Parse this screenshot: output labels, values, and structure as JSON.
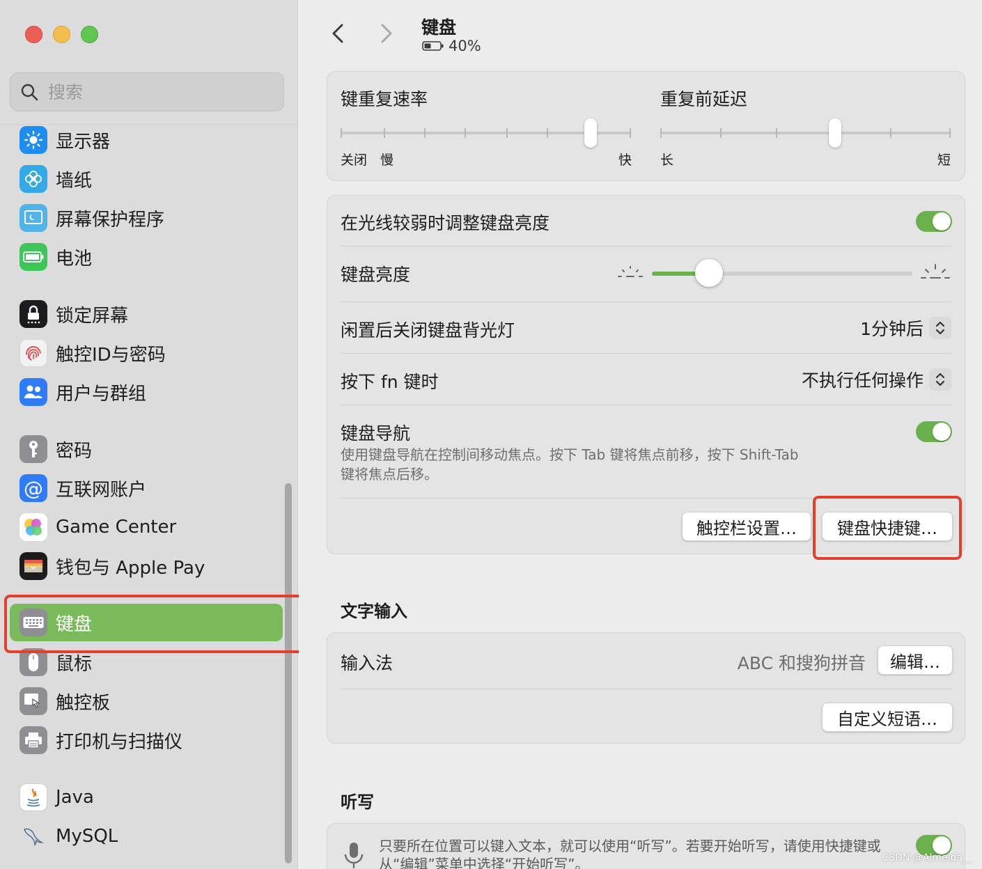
{
  "sidebar": {
    "search_placeholder": "搜索",
    "groups": [
      [
        {
          "id": "display",
          "label": "显示器",
          "icon": "sun-icon",
          "color": "#1f8cf0"
        },
        {
          "id": "wallpaper",
          "label": "墙纸",
          "icon": "flower-icon",
          "color": "#35a8e8"
        },
        {
          "id": "screensaver",
          "label": "屏幕保护程序",
          "icon": "screensaver-icon",
          "color": "#52b3e8"
        },
        {
          "id": "battery",
          "label": "电池",
          "icon": "battery-icon",
          "color": "#3dc55a"
        }
      ],
      [
        {
          "id": "lockscreen",
          "label": "锁定屏幕",
          "icon": "lock-icon",
          "color": "#1c1c1e"
        },
        {
          "id": "touchid",
          "label": "触控ID与密码",
          "icon": "fingerprint-icon",
          "color": "#f2f2f2"
        },
        {
          "id": "users",
          "label": "用户与群组",
          "icon": "users-icon",
          "color": "#2f7cf6"
        }
      ],
      [
        {
          "id": "passwords",
          "label": "密码",
          "icon": "key-icon",
          "color": "#8e8e93"
        },
        {
          "id": "internet-accounts",
          "label": "互联网账户",
          "icon": "at-icon",
          "color": "#2f7cf6"
        },
        {
          "id": "game-center",
          "label": "Game Center",
          "icon": "game-center-icon",
          "color": "#ffffff"
        },
        {
          "id": "wallet",
          "label": "钱包与 Apple Pay",
          "icon": "wallet-icon",
          "color": "#1c1c1e"
        }
      ],
      [
        {
          "id": "keyboard",
          "label": "键盘",
          "icon": "keyboard-icon",
          "color": "#8e8e93",
          "selected": true
        },
        {
          "id": "mouse",
          "label": "鼠标",
          "icon": "mouse-icon",
          "color": "#8e8e93"
        },
        {
          "id": "trackpad",
          "label": "触控板",
          "icon": "trackpad-icon",
          "color": "#8e8e93"
        },
        {
          "id": "printers",
          "label": "打印机与扫描仪",
          "icon": "printer-icon",
          "color": "#8e8e93"
        }
      ],
      [
        {
          "id": "java",
          "label": "Java",
          "icon": "java-icon",
          "color": "#ffffff"
        },
        {
          "id": "mysql",
          "label": "MySQL",
          "icon": "mysql-dolphin-icon",
          "color": "transparent"
        }
      ]
    ]
  },
  "header": {
    "title": "键盘",
    "battery": "40%"
  },
  "repeat": {
    "rate_label": "键重复速率",
    "rate_off": "关闭",
    "rate_slow": "慢",
    "rate_fast": "快",
    "rate_value": 0.86,
    "delay_label": "重复前延迟",
    "delay_long": "长",
    "delay_short": "短",
    "delay_value": 0.6
  },
  "settings": {
    "auto_brightness_label": "在光线较弱时调整键盘亮度",
    "auto_brightness_on": true,
    "brightness_label": "键盘亮度",
    "brightness_value": 0.22,
    "backlight_off_label": "闲置后关闭键盘背光灯",
    "backlight_off_value": "1分钟后",
    "fn_label": "按下 fn 键时",
    "fn_value": "不执行任何操作",
    "nav_label": "键盘导航",
    "nav_on": true,
    "nav_desc_line1": "使用键盘导航在控制间移动焦点。按下 Tab 键将焦点前移，按下 Shift-Tab",
    "nav_desc_line2": "键将焦点后移。",
    "touchbar_button": "触控栏设置…",
    "shortcuts_button": "键盘快捷键…"
  },
  "text_input": {
    "section_title": "文字输入",
    "input_method_label": "输入法",
    "input_method_value": "ABC 和搜狗拼音",
    "edit_button": "编辑…",
    "custom_phrase_button": "自定义短语…"
  },
  "dictation": {
    "section_title": "听写",
    "desc_line1": "只要所在位置可以键入文本，就可以使用“听写”。若要开始听写，请使用快捷键或",
    "desc_line2": "从“编辑”菜单中选择“开始听写”。",
    "enabled": true
  },
  "watermark": "CSDN @Almeida__",
  "colors": {
    "accent_green": "#6ab04c",
    "selected_row": "#7bba5b",
    "highlight_red": "#e0402d"
  }
}
